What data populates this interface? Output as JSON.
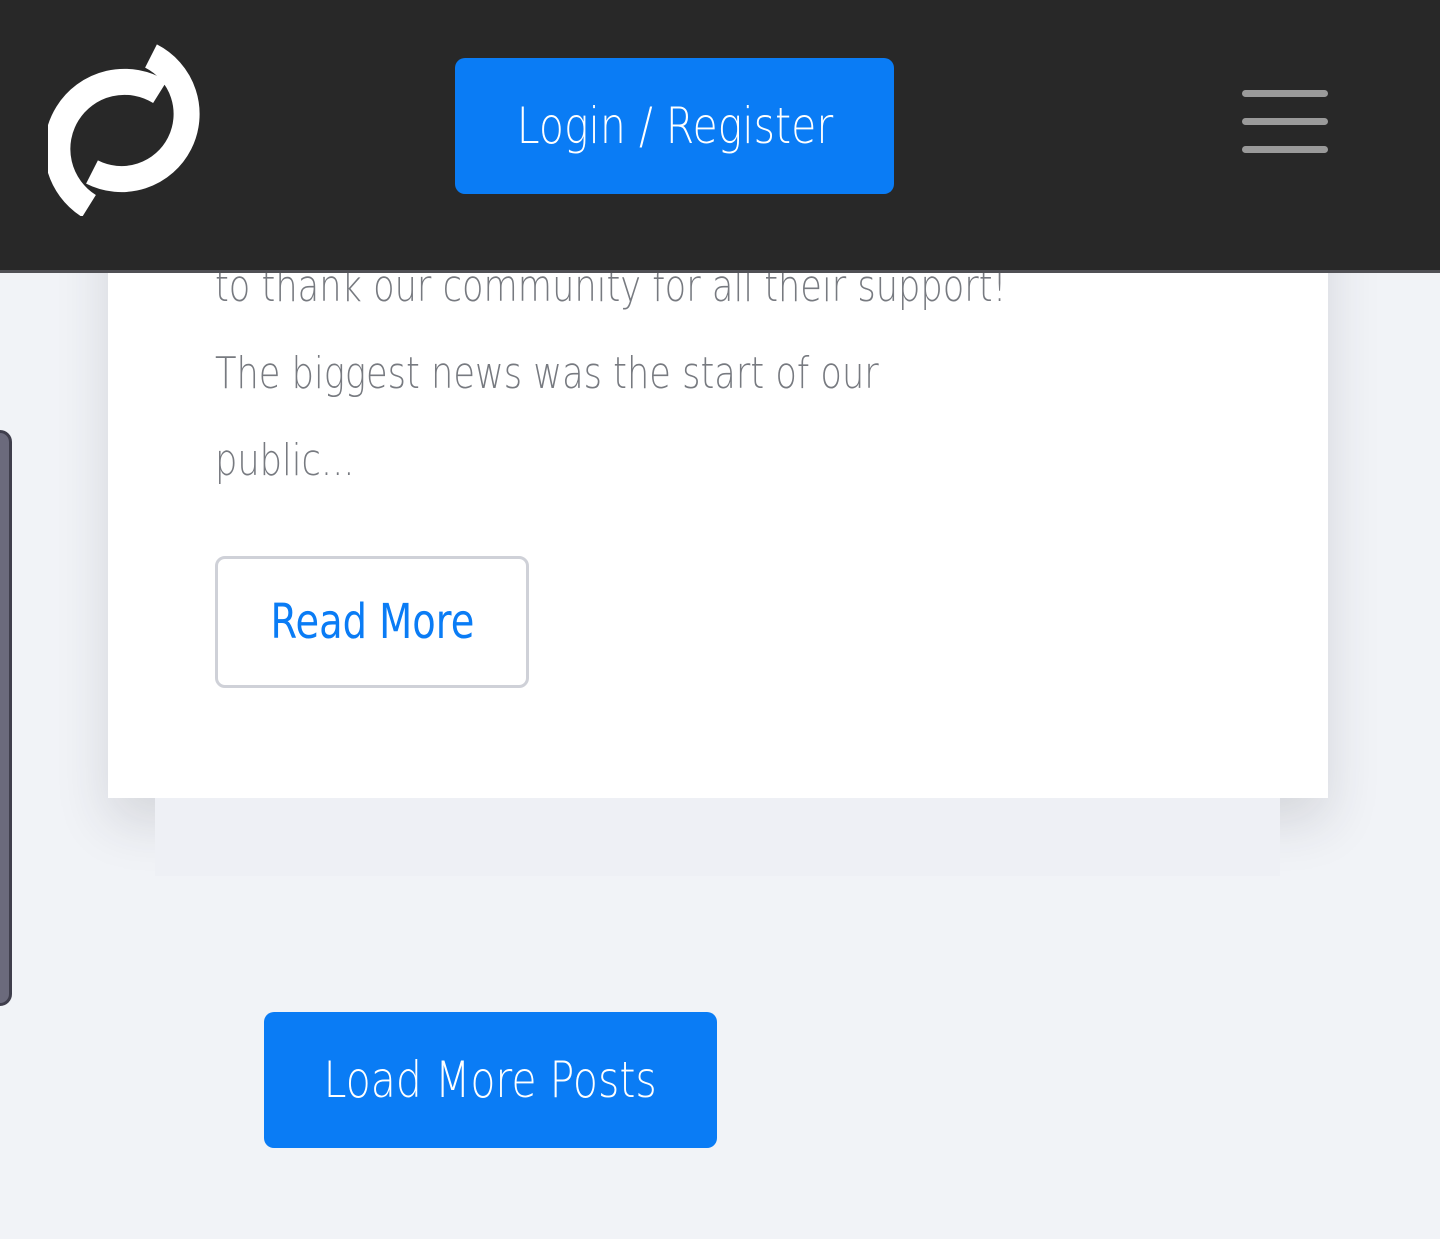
{
  "header": {
    "login_label": "Login / Register",
    "logo_icon": "sync-arrows-logo-icon",
    "menu_icon": "hamburger-menu-icon",
    "background_color": "#282828",
    "accent_color": "#0a7cf5"
  },
  "post": {
    "excerpt_lines": [
      "to thank our community for all their support!",
      "The biggest news was the start of our",
      "public..."
    ],
    "read_more_label": "Read More"
  },
  "pagination": {
    "load_more_label": "Load More Posts"
  }
}
